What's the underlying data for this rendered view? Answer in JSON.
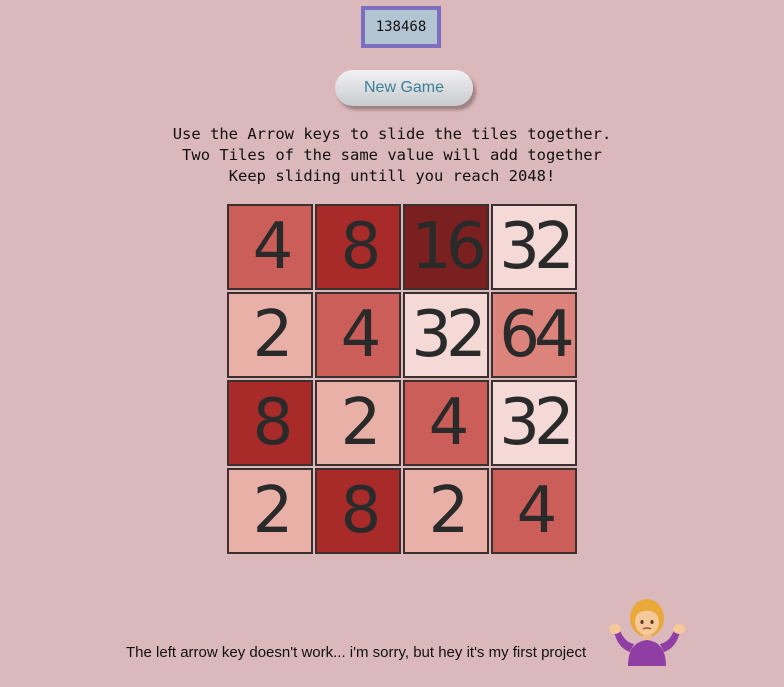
{
  "score": "138468",
  "new_game_label": "New Game",
  "instructions": [
    "Use the Arrow keys to slide the tiles together.",
    "Two Tiles of the same value will add together",
    "Keep sliding untill you reach 2048!"
  ],
  "board": [
    [
      4,
      8,
      16,
      32
    ],
    [
      2,
      4,
      32,
      64
    ],
    [
      8,
      2,
      4,
      32
    ],
    [
      2,
      8,
      2,
      4
    ]
  ],
  "tile_colors": {
    "2": "#e8b0a7",
    "4": "#cc5e5a",
    "8": "#a82b2a",
    "16": "#7b2020",
    "32": "#f4d9d6",
    "64": "#dc847c"
  },
  "footer_text": "The left arrow key doesn't work... i'm sorry, but hey it's my first project",
  "footer_icon": "person-shrugging-icon"
}
